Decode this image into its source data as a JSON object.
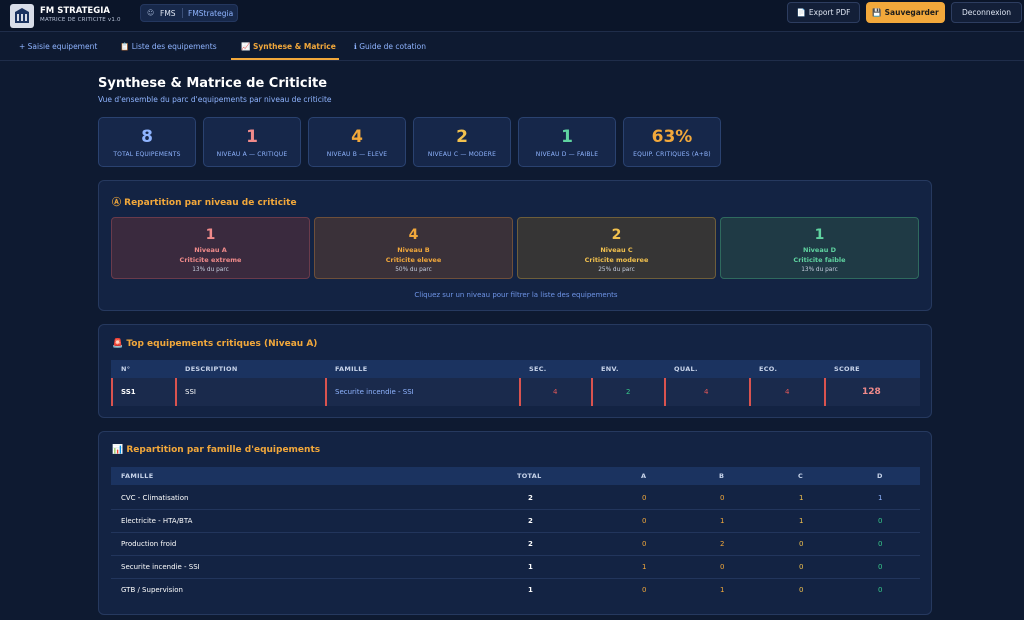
{
  "header": {
    "brand": "FM STRATEGIA",
    "brand_sub": "MATRICE DE CRITICITE v1.0",
    "org": "FMS",
    "user": "FMStrategia",
    "export_label": "Export PDF",
    "save_label": "Sauvegarder",
    "logout_label": "Deconnexion"
  },
  "tabs": [
    {
      "label": "+ Saisie equipement",
      "icon": "plus-icon"
    },
    {
      "label": "Liste des equipements",
      "icon": "clipboard-icon"
    },
    {
      "label": "Synthese & Matrice",
      "icon": "chart-icon",
      "active": true
    },
    {
      "label": "Guide de cotation",
      "icon": "info-icon"
    }
  ],
  "page": {
    "title": "Synthese & Matrice de Criticite",
    "subtitle": "Vue d'ensemble du parc d'equipements par niveau de criticite"
  },
  "stats": [
    {
      "value": "8",
      "label": "TOTAL EQUIPEMENTS",
      "color": "#8fb4ff"
    },
    {
      "value": "1",
      "label": "NIVEAU A — CRITIQUE",
      "color": "#f08a8a"
    },
    {
      "value": "4",
      "label": "NIVEAU B — ELEVE",
      "color": "#f2a83b"
    },
    {
      "value": "2",
      "label": "NIVEAU C — MODERE",
      "color": "#f2c14e"
    },
    {
      "value": "1",
      "label": "NIVEAU D — FAIBLE",
      "color": "#5fd3a0"
    },
    {
      "value": "63%",
      "label": "EQUIP. CRITIQUES (A+B)",
      "color": "#f2a83b"
    }
  ],
  "repartition": {
    "title": "Repartition par niveau de criticite",
    "levels": [
      {
        "count": "1",
        "name": "Niveau A",
        "desc": "Criticite extreme",
        "share": "13% du parc",
        "color": "#f08a8a",
        "bg": "#3a2a3e",
        "border": "#6a3b4b"
      },
      {
        "count": "4",
        "name": "Niveau B",
        "desc": "Criticite elevee",
        "share": "50% du parc",
        "color": "#f2a83b",
        "bg": "#3a3139",
        "border": "#6e4f3a"
      },
      {
        "count": "2",
        "name": "Niveau C",
        "desc": "Criticite moderee",
        "share": "25% du parc",
        "color": "#f2c14e",
        "bg": "#363535",
        "border": "#6e5e3a"
      },
      {
        "count": "1",
        "name": "Niveau D",
        "desc": "Criticite faible",
        "share": "13% du parc",
        "color": "#5fd3a0",
        "bg": "#1f3a45",
        "border": "#2f6a5e"
      }
    ],
    "hint": "Cliquez sur un niveau pour filtrer la liste des equipements"
  },
  "top_critiques": {
    "title": "Top equipements critiques (Niveau A)",
    "columns": [
      "N°",
      "DESCRIPTION",
      "FAMILLE",
      "SEC.",
      "ENV.",
      "QUAL.",
      "ECO.",
      "SCORE"
    ],
    "rows": [
      {
        "num": "SS1",
        "description": "SSI",
        "famille": "Securite incendie - SSI",
        "sec": "4",
        "env": "2",
        "qual": "4",
        "eco": "4",
        "score": "128"
      }
    ]
  },
  "familles": {
    "title": "Repartition par famille d'equipements",
    "columns": [
      "FAMILLE",
      "TOTAL",
      "A",
      "B",
      "C",
      "D"
    ],
    "rows": [
      {
        "famille": "CVC - Climatisation",
        "total": "2",
        "a": "0",
        "b": "0",
        "c": "1",
        "d": "1"
      },
      {
        "famille": "Electricite - HTA/BTA",
        "total": "2",
        "a": "0",
        "b": "1",
        "c": "1",
        "d": "0"
      },
      {
        "famille": "Production froid",
        "total": "2",
        "a": "0",
        "b": "2",
        "c": "0",
        "d": "0"
      },
      {
        "famille": "Securite incendie - SSI",
        "total": "1",
        "a": "1",
        "b": "0",
        "c": "0",
        "d": "0"
      },
      {
        "famille": "GTB / Supervision",
        "total": "1",
        "a": "0",
        "b": "1",
        "c": "0",
        "d": "0"
      }
    ]
  }
}
